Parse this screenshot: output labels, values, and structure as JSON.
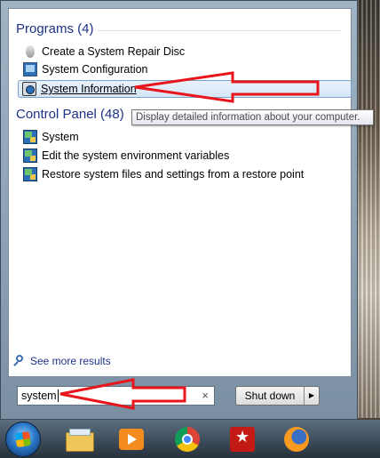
{
  "programs": {
    "title": "Programs (4)",
    "items": [
      {
        "label": "Create a System Repair Disc",
        "icon": "repair-disc-icon"
      },
      {
        "label": "System Configuration",
        "icon": "system-config-icon"
      },
      {
        "label": "System Information",
        "icon": "system-info-icon",
        "selected": true
      }
    ]
  },
  "control_panel": {
    "title": "Control Panel (48)",
    "items": [
      {
        "label": "System",
        "icon": "control-panel-icon"
      },
      {
        "label": "Edit the system environment variables",
        "icon": "control-panel-icon"
      },
      {
        "label": "Restore system files and settings from a restore point",
        "icon": "control-panel-icon"
      }
    ]
  },
  "tooltip": "Display detailed information about your computer.",
  "see_more": "See more results",
  "search": {
    "value": "system",
    "clear": "×"
  },
  "shutdown": {
    "label": "Shut down",
    "arrow": "▶"
  },
  "annotation_color": "#e8151b",
  "taskbar": {
    "items": [
      "start-orb",
      "windows-explorer-icon",
      "media-player-icon",
      "chrome-icon",
      "acrobat-icon",
      "firefox-icon"
    ]
  }
}
